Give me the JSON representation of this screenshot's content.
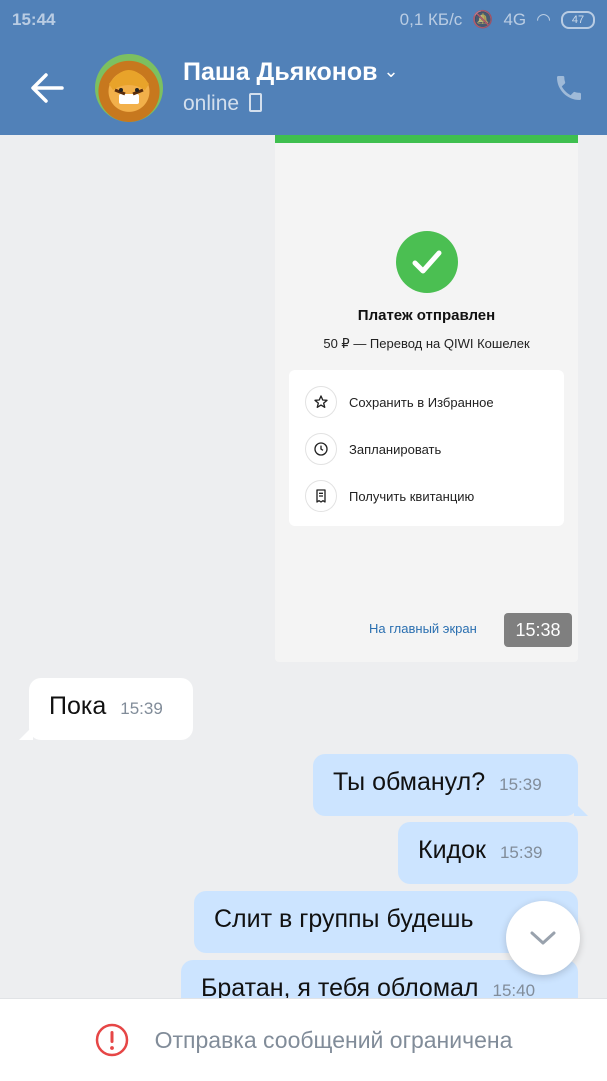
{
  "status_bar": {
    "time": "15:44",
    "speed": "0,1 КБ/с",
    "network": "4G",
    "battery": "47"
  },
  "header": {
    "name": "Паша Дьяконов",
    "status": "online"
  },
  "attachment": {
    "title": "Платеж отправлен",
    "subtitle": "50 ₽ — Перевод на QIWI Кошелек",
    "actions": [
      {
        "label": "Сохранить в Избранное",
        "icon": "star-icon"
      },
      {
        "label": "Запланировать",
        "icon": "clock-icon"
      },
      {
        "label": "Получить квитанцию",
        "icon": "receipt-icon"
      }
    ],
    "home_link": "На главный экран",
    "time": "15:38"
  },
  "messages": [
    {
      "direction": "in",
      "text": "Пока",
      "time": "15:39"
    },
    {
      "direction": "out",
      "text": "Ты обманул?",
      "time": "15:39"
    },
    {
      "direction": "out",
      "text": "Кидок",
      "time": "15:39"
    },
    {
      "direction": "out",
      "text": "Слит в группы будешь",
      "time": ""
    },
    {
      "direction": "out",
      "text": "Братан, я тебя обломал",
      "time": "15:40"
    }
  ],
  "footer": {
    "notice": "Отправка сообщений ограничена"
  },
  "colors": {
    "header": "#5181b8",
    "outgoing_bubble": "#cce4ff",
    "success_green": "#4bbf52",
    "warning_red": "#e64646"
  }
}
